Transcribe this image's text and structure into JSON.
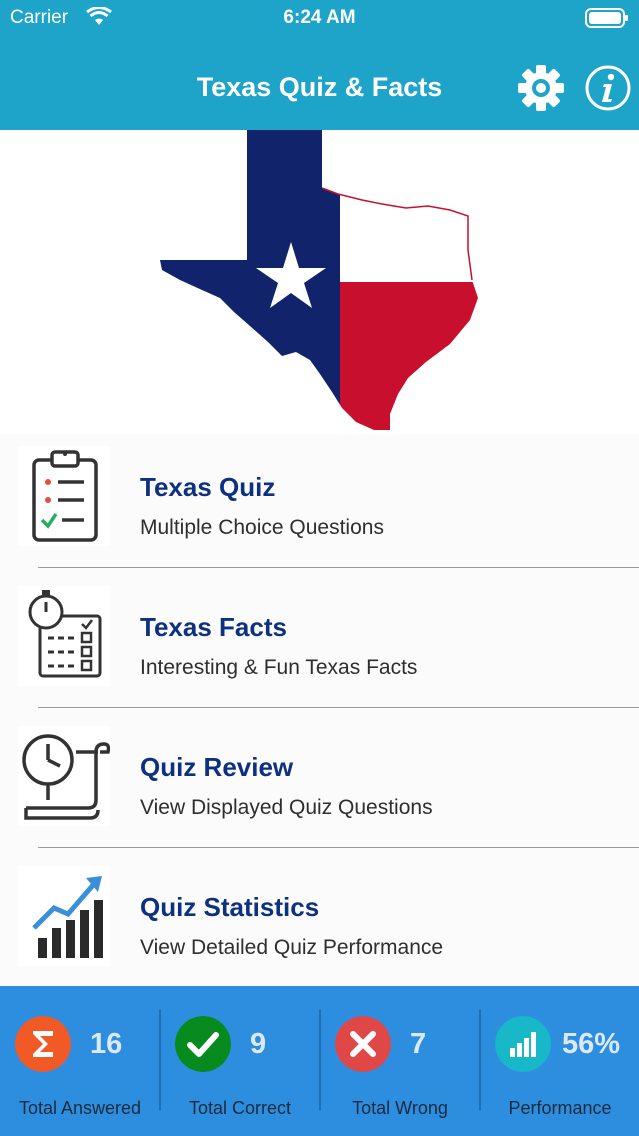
{
  "status": {
    "carrier": "Carrier",
    "time": "6:24 AM"
  },
  "header": {
    "title": "Texas Quiz & Facts",
    "settings_icon": "gear-icon",
    "info_icon": "info-icon"
  },
  "colors": {
    "header": "#1ea3c9",
    "title_blue": "#0d3080",
    "stats_bg": "#2d8ee0",
    "red": "#f15a24",
    "green": "#078a1e",
    "wrong": "#e04848",
    "teal": "#18b8c8"
  },
  "menu": [
    {
      "title": "Texas Quiz",
      "subtitle": "Multiple Choice Questions",
      "icon": "clipboard-checklist-icon"
    },
    {
      "title": "Texas Facts",
      "subtitle": "Interesting & Fun Texas Facts",
      "icon": "stopwatch-list-icon"
    },
    {
      "title": "Quiz Review",
      "subtitle": "View Displayed Quiz Questions",
      "icon": "clock-scroll-icon"
    },
    {
      "title": "Quiz Statistics",
      "subtitle": "View Detailed Quiz Performance",
      "icon": "rising-chart-icon"
    }
  ],
  "stats": [
    {
      "value": "16",
      "label": "Total Answered",
      "icon": "sigma-icon"
    },
    {
      "value": "9",
      "label": "Total Correct",
      "icon": "check-icon"
    },
    {
      "value": "7",
      "label": "Total Wrong",
      "icon": "x-icon"
    },
    {
      "value": "56%",
      "label": "Performance",
      "icon": "bar-chart-icon"
    }
  ]
}
